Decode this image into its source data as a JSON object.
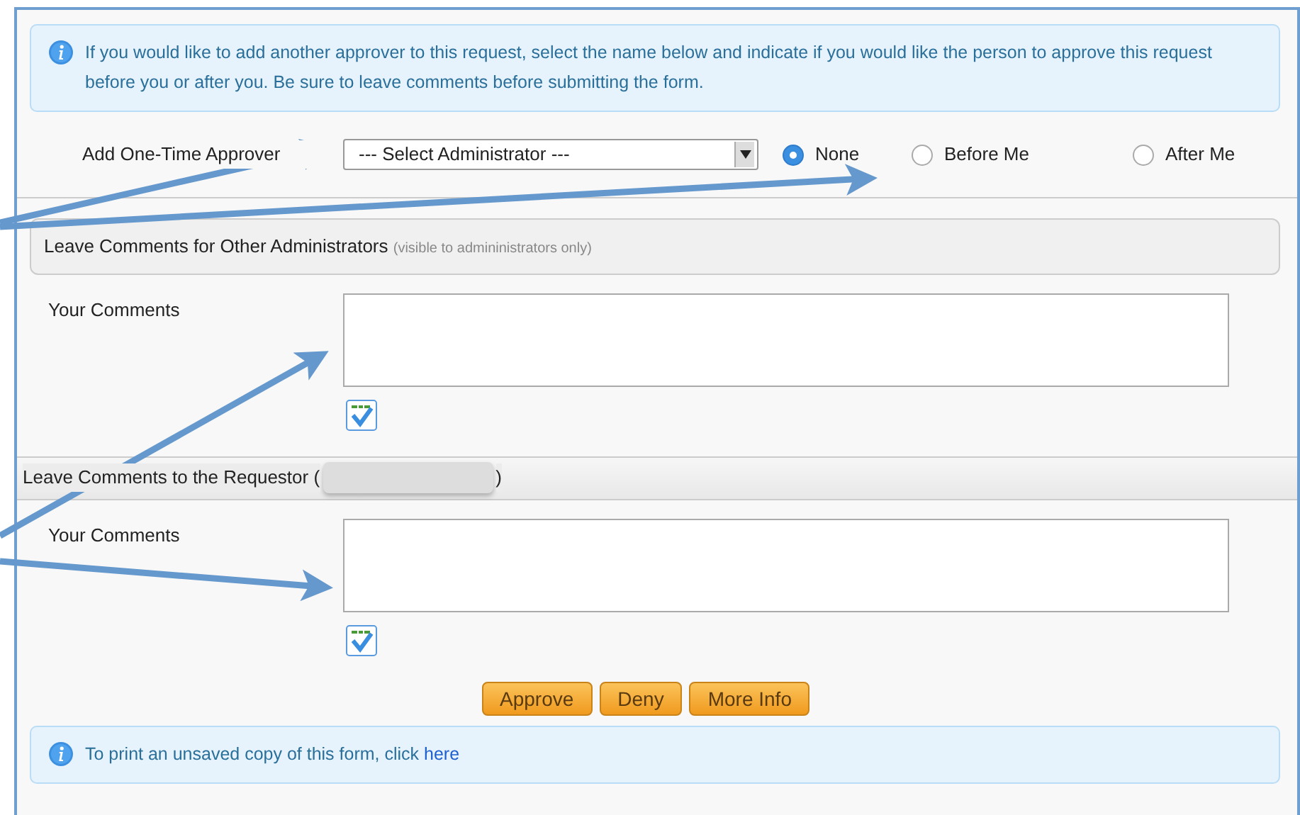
{
  "info_top": {
    "text": "If you would like to add another approver to this request, select the name below and indicate if you would like the person to approve this request before you or after you. Be sure to leave comments before submitting the form."
  },
  "approver": {
    "label": "Add One-Time Approver",
    "select_value": "--- Select Administrator ---",
    "options": [
      {
        "label": "None",
        "selected": true
      },
      {
        "label": "Before Me",
        "selected": false
      },
      {
        "label": "After Me",
        "selected": false
      }
    ]
  },
  "sections": [
    {
      "kind": "panel",
      "title": "Leave Comments for Other Administrators",
      "note": "(visible to admininistrators only)",
      "field_label": "Your Comments"
    },
    {
      "kind": "bar",
      "title": "Leave Comments to the Requestor (",
      "title_end": ")",
      "redacted": true,
      "field_label": "Your Comments"
    }
  ],
  "buttons": [
    "Approve",
    "Deny",
    "More Info"
  ],
  "info_bottom": {
    "text": "To print an unsaved copy of this form, click ",
    "link": "here"
  }
}
